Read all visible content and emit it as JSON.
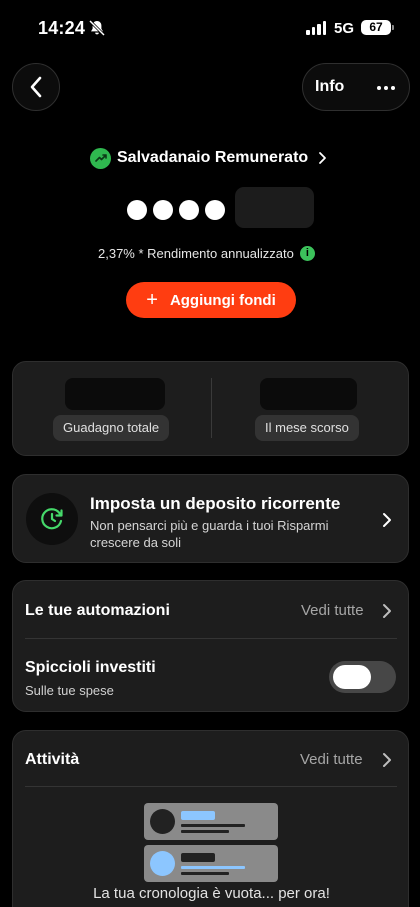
{
  "status_bar": {
    "time": "14:24",
    "network": "5G",
    "battery": "67"
  },
  "nav": {
    "info_label": "Info"
  },
  "account": {
    "title": "Salvadanaio Remunerato",
    "yield_text": "2,37% * Rendimento annualizzato",
    "add_funds_label": "Aggiungi fondi"
  },
  "stats": {
    "total_gain_label": "Guadagno totale",
    "last_month_label": "Il mese scorso"
  },
  "recurring_deposit": {
    "title": "Imposta un deposito ricorrente",
    "subtitle": "Non pensarci più e guarda i tuoi Risparmi crescere da soli"
  },
  "automations": {
    "title": "Le tue automazioni",
    "see_all": "Vedi tutte",
    "roundup_title": "Spiccioli investiti",
    "roundup_subtitle": "Sulle tue spese",
    "roundup_enabled": false
  },
  "activity": {
    "title": "Attività",
    "see_all": "Vedi tutte",
    "empty_text": "La tua cronologia è vuota... per ora!"
  },
  "colors": {
    "accent": "#ff3d11",
    "success": "#2fb84f",
    "card": "#1d1d1d",
    "preview_blue": "#8cc6ff"
  }
}
